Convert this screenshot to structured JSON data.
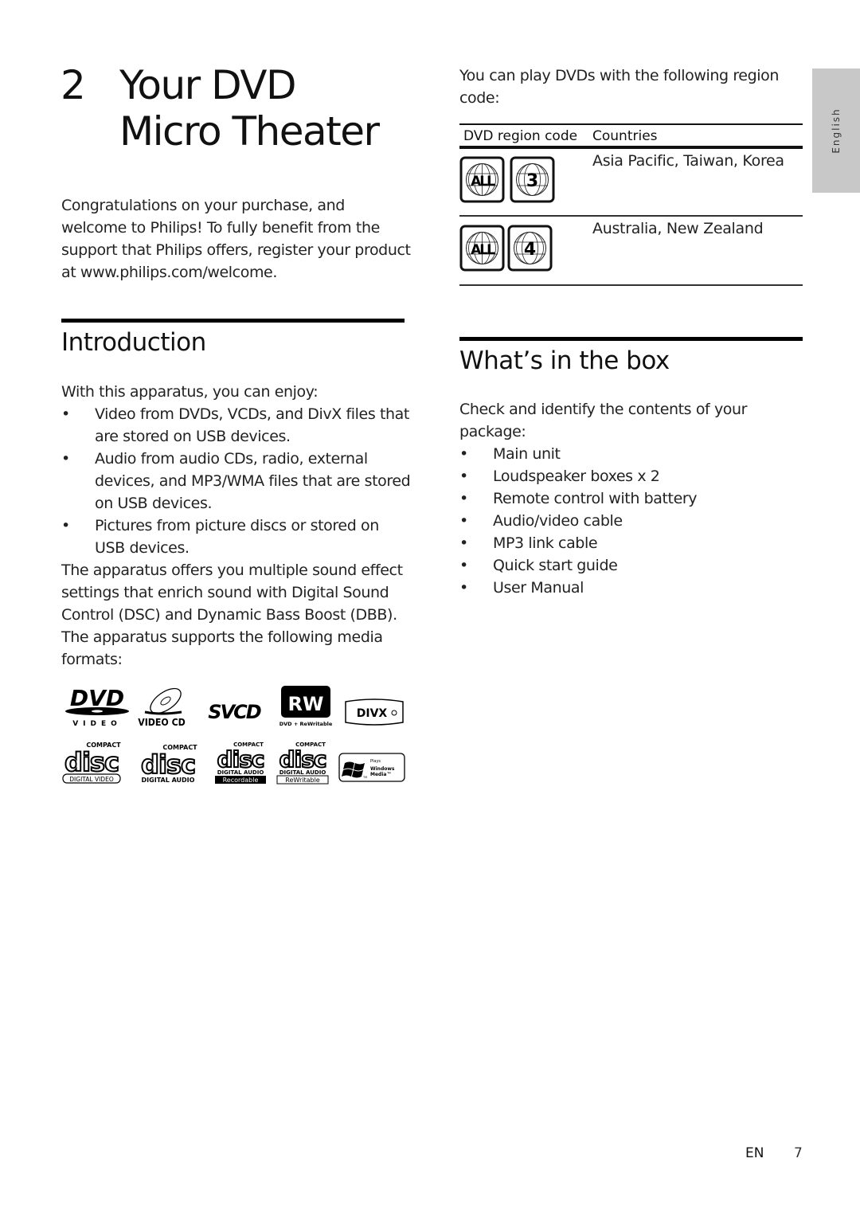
{
  "chapter": {
    "number": "2",
    "title_line1": "Your DVD",
    "title_line2": "Micro Theater"
  },
  "welcome": {
    "text": "Congratulations on your purchase, and welcome to Philips! To fully benefit from the support that Philips offers, register your product at www.philips.com/welcome."
  },
  "introduction": {
    "heading": "Introduction",
    "lead": "With this apparatus, you can enjoy:",
    "bullets": [
      "Video from DVDs, VCDs, and DivX files that are stored on USB devices.",
      "Audio from audio CDs, radio, external devices, and MP3/WMA files that are stored on USB devices.",
      "Pictures from picture discs or stored on USB devices."
    ],
    "paragraph": "The apparatus offers you multiple sound effect settings that enrich sound with Digital Sound Control (DSC) and Dynamic Bass Boost (DBB). The apparatus supports the following media formats:"
  },
  "media_logos": {
    "row1": [
      {
        "icon": "dvd-video-logo",
        "text_main": "DVD",
        "text_sub": "VIDEO"
      },
      {
        "icon": "video-cd-logo",
        "text_sub": "VIDEO CD"
      },
      {
        "icon": "svcd-logo",
        "text_main": "SVCD"
      },
      {
        "icon": "dvd-rewritable-logo",
        "text_main": "RW",
        "text_sub": "DVD + ReWritable"
      },
      {
        "icon": "divx-logo",
        "text_main": "DIVX"
      }
    ],
    "row2": [
      {
        "icon": "compact-disc-digital-video-logo",
        "text_top": "COMPACT",
        "text_main": "disc",
        "text_sub": "DIGITAL VIDEO"
      },
      {
        "icon": "compact-disc-digital-audio-logo",
        "text_top": "COMPACT",
        "text_main": "disc",
        "text_sub": "DIGITAL AUDIO"
      },
      {
        "icon": "compact-disc-recordable-logo",
        "text_top": "COMPACT",
        "text_main": "disc",
        "text_sub": "DIGITAL AUDIO",
        "text_badge": "Recordable"
      },
      {
        "icon": "compact-disc-rewritable-logo",
        "text_top": "COMPACT",
        "text_main": "disc",
        "text_sub": "DIGITAL AUDIO",
        "text_badge": "ReWritable"
      },
      {
        "icon": "windows-media-logo",
        "text_top": "Plays",
        "text_main": "Windows",
        "text_sub": "Media™",
        "text_tm": "TM"
      }
    ]
  },
  "region": {
    "intro": "You can play DVDs with the following region code:",
    "headers": {
      "code": "DVD region code",
      "countries": "Countries"
    },
    "rows": [
      {
        "badges": [
          "ALL",
          "3"
        ],
        "countries": "Asia Pacific, Taiwan, Korea"
      },
      {
        "badges": [
          "ALL",
          "4"
        ],
        "countries": "Australia, New Zealand"
      }
    ]
  },
  "whats_in_box": {
    "heading": "What’s in the box",
    "lead": "Check and identify the contents of your package:",
    "items": [
      "Main unit",
      "Loudspeaker boxes x 2",
      "Remote control with battery",
      "Audio/video cable",
      "MP3 link cable",
      "Quick start guide",
      "User Manual"
    ]
  },
  "side_tab": {
    "label": "English"
  },
  "footer": {
    "lang": "EN",
    "page": "7"
  }
}
